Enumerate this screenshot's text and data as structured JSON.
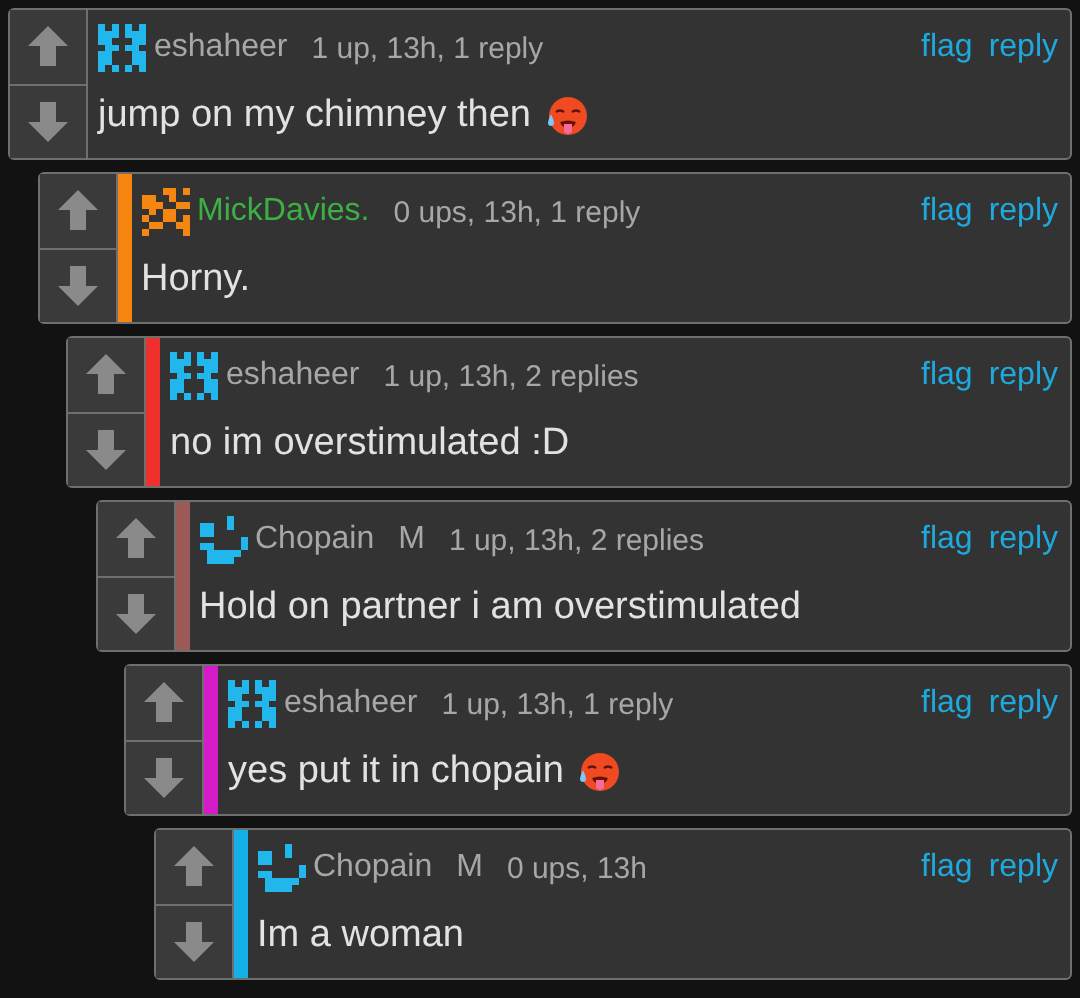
{
  "comments": [
    {
      "avatar": {
        "kind": "w"
      },
      "user": {
        "name": "eshaheer"
      },
      "meta": "1 up, 13h, 1 reply",
      "actions": [
        "flag",
        "reply"
      ],
      "text": "jump on my chimney then",
      "emoji": {
        "kind": "hot-face"
      },
      "children": [
        {
          "avatar": {
            "kind": "checker"
          },
          "user": {
            "name": "MickDavies.",
            "color": "#3cb043"
          },
          "meta": "0 ups, 13h, 1 reply",
          "actions": [
            "flag",
            "reply"
          ],
          "text": "Horny.",
          "color": "#f5860f",
          "children": [
            {
              "avatar": {
                "kind": "w"
              },
              "user": {
                "name": "eshaheer"
              },
              "meta": "1 up, 13h, 2 replies",
              "actions": [
                "flag",
                "reply"
              ],
              "text": "no im overstimulated :D",
              "color": "#f0302c",
              "children": [
                {
                  "avatar": {
                    "kind": "smile"
                  },
                  "user": {
                    "name": "Chopain"
                  },
                  "badge": "M",
                  "meta": "1 up, 13h, 2 replies",
                  "actions": [
                    "flag",
                    "reply"
                  ],
                  "text": "Hold on partner i am overstimulated",
                  "color": "#9b5a55",
                  "children": [
                    {
                      "avatar": {
                        "kind": "w"
                      },
                      "user": {
                        "name": "eshaheer"
                      },
                      "meta": "1 up, 13h, 1 reply",
                      "actions": [
                        "flag",
                        "reply"
                      ],
                      "text": "yes put it in chopain",
                      "emoji": {
                        "kind": "hot-face"
                      },
                      "color": "#d51cc8",
                      "children": [
                        {
                          "avatar": {
                            "kind": "smile"
                          },
                          "user": {
                            "name": "Chopain"
                          },
                          "badge": "M",
                          "meta": "0 ups, 13h",
                          "actions": [
                            "flag",
                            "reply"
                          ],
                          "text": "Im a woman",
                          "color": "#16b0e8"
                        }
                      ]
                    }
                  ]
                }
              ]
            }
          ]
        }
      ]
    }
  ]
}
